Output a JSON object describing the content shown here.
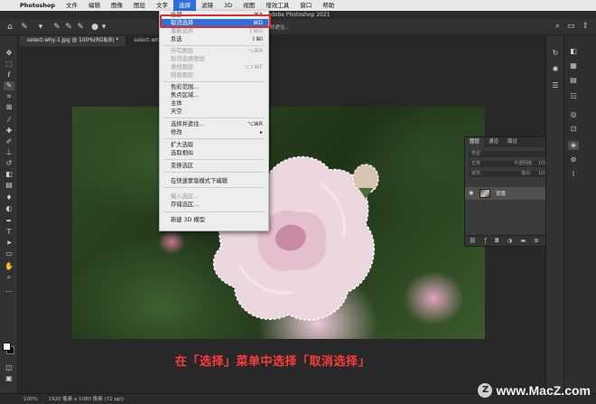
{
  "menubar": {
    "items": [
      "Photoshop",
      "文件",
      "编辑",
      "图像",
      "图层",
      "文字",
      "选择",
      "滤镜",
      "3D",
      "视图",
      "增效工具",
      "窗口",
      "帮助"
    ],
    "active_index": 6
  },
  "window": {
    "title": "Adobe Photoshop 2021"
  },
  "options_bar": {
    "select_mask_label": "选择并遮住..."
  },
  "tabs": [
    {
      "label": "select-why-1.jpg @ 100%(RGB/8) *"
    },
    {
      "label": "select-why-..."
    }
  ],
  "select_menu": {
    "items": [
      {
        "label": "全部",
        "shortcut": "⌘A",
        "disabled": false
      },
      {
        "label": "取消选择",
        "shortcut": "⌘D",
        "disabled": false,
        "highlighted": true
      },
      {
        "label": "重新选择",
        "shortcut": "⇧⌘D",
        "disabled": true
      },
      {
        "label": "反选",
        "shortcut": "⇧⌘I",
        "disabled": false
      },
      {
        "label": "所有图层",
        "shortcut": "⌥⌘A",
        "disabled": true
      },
      {
        "label": "取消选择图层",
        "shortcut": "",
        "disabled": true
      },
      {
        "label": "查找图层",
        "shortcut": "⌥⇧⌘F",
        "disabled": true
      },
      {
        "label": "隔离图层",
        "shortcut": "",
        "disabled": true
      },
      {
        "label": "色彩范围...",
        "shortcut": "",
        "disabled": false
      },
      {
        "label": "焦点区域...",
        "shortcut": "",
        "disabled": false
      },
      {
        "label": "主体",
        "shortcut": "",
        "disabled": false
      },
      {
        "label": "天空",
        "shortcut": "",
        "disabled": false
      },
      {
        "label": "选择并遮住...",
        "shortcut": "⌥⌘R",
        "disabled": false
      },
      {
        "label": "修改",
        "shortcut": "▸",
        "disabled": false
      },
      {
        "label": "扩大选取",
        "shortcut": "",
        "disabled": false
      },
      {
        "label": "选取相似",
        "shortcut": "",
        "disabled": false
      },
      {
        "label": "变换选区",
        "shortcut": "",
        "disabled": false
      },
      {
        "label": "在快速蒙版模式下编辑",
        "shortcut": "",
        "disabled": false
      },
      {
        "label": "载入选区...",
        "shortcut": "",
        "disabled": true
      },
      {
        "label": "存储选区...",
        "shortcut": "",
        "disabled": false
      },
      {
        "label": "新建 3D 模型",
        "shortcut": "",
        "disabled": false
      }
    ]
  },
  "layers_panel": {
    "tabs": [
      "图层",
      "通道",
      "路径"
    ],
    "kind_label": "类型",
    "blend_mode": "正常",
    "opacity_label": "不透明度:",
    "opacity_value": "100%",
    "lock_label": "锁定:",
    "fill_label": "填充:",
    "fill_value": "100%",
    "layer_name": "背景"
  },
  "status_bar": {
    "zoom": "100%",
    "doc_info": "1920 像素 x 1080 像素 (72 ppi)"
  },
  "caption": "在「选择」菜单中选择「取消选择」",
  "watermark": "www.MacZ.com"
}
